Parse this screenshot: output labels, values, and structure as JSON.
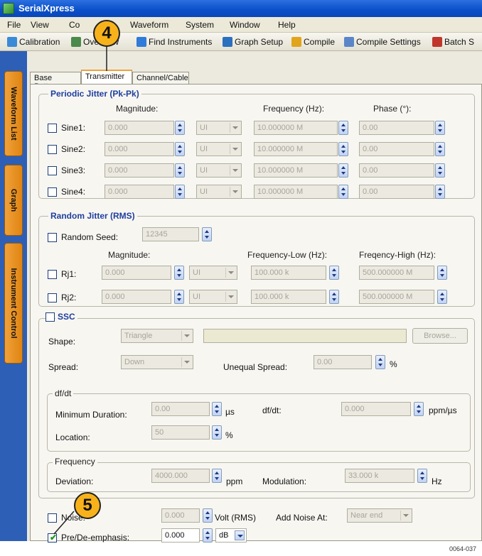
{
  "window": {
    "title": "SerialXpress"
  },
  "menu": [
    "File",
    "View",
    "Co",
    "Waveform",
    "System",
    "Window",
    "Help"
  ],
  "toolbar": [
    {
      "label": "Calibration",
      "icon": "calibration-icon",
      "color": "#3a8ad8"
    },
    {
      "label": "Overview",
      "icon": "overview-icon",
      "color": "#4a8a4a"
    },
    {
      "label": "Find Instruments",
      "icon": "find-instruments-icon",
      "color": "#2f7bd9"
    },
    {
      "label": "Graph Setup",
      "icon": "graph-setup-icon",
      "color": "#2b6fbf"
    },
    {
      "label": "Compile",
      "icon": "compile-icon",
      "color": "#e2a41a"
    },
    {
      "label": "Compile Settings",
      "icon": "compile-settings-icon",
      "color": "#5a86c9"
    },
    {
      "label": "Batch S",
      "icon": "batch-icon",
      "color": "#c0362c"
    }
  ],
  "side_tabs": [
    "Waveform List",
    "Graph",
    "Instrument Control"
  ],
  "tabs": [
    "Base Pattern",
    "Transmitter",
    "Channel/Cable"
  ],
  "callouts": [
    "4",
    "5"
  ],
  "periodic": {
    "title": "Periodic Jitter (Pk-Pk)",
    "headers": {
      "magnitude": "Magnitude:",
      "frequency": "Frequency (Hz):",
      "phase": "Phase (°):"
    },
    "rows": [
      {
        "label": "Sine1:",
        "magnitude": "0.000",
        "unit": "UI",
        "frequency": "10.000000 M",
        "phase": "0.00"
      },
      {
        "label": "Sine2:",
        "magnitude": "0.000",
        "unit": "UI",
        "frequency": "10.000000 M",
        "phase": "0.00"
      },
      {
        "label": "Sine3:",
        "magnitude": "0.000",
        "unit": "UI",
        "frequency": "10.000000 M",
        "phase": "0.00"
      },
      {
        "label": "Sine4:",
        "magnitude": "0.000",
        "unit": "UI",
        "frequency": "10.000000 M",
        "phase": "0.00"
      }
    ]
  },
  "random": {
    "title": "Random Jitter (RMS)",
    "seed_label": "Random Seed:",
    "seed_value": "12345",
    "headers": {
      "magnitude": "Magnitude:",
      "freq_low": "Frequency-Low (Hz):",
      "freq_high": "Freqency-High (Hz):"
    },
    "rows": [
      {
        "label": "Rj1:",
        "magnitude": "0.000",
        "unit": "UI",
        "low": "100.000 k",
        "high": "500.000000 M"
      },
      {
        "label": "Rj2:",
        "magnitude": "0.000",
        "unit": "UI",
        "low": "100.000 k",
        "high": "500.000000 M"
      }
    ]
  },
  "ssc": {
    "title": "SSC",
    "shape_label": "Shape:",
    "shape_value": "Triangle",
    "browse": "Browse...",
    "spread_label": "Spread:",
    "spread_value": "Down",
    "unequal_label": "Unequal Spread:",
    "unequal_value": "0.00",
    "unequal_unit": "%",
    "dfdt": {
      "title": "df/dt",
      "min_label": "Minimum Duration:",
      "min_value": "0.00",
      "min_unit": "µs",
      "dfdt_label": "df/dt:",
      "dfdt_value": "0.000",
      "dfdt_unit": "ppm/µs",
      "loc_label": "Location:",
      "loc_value": "50",
      "loc_unit": "%"
    },
    "frequency": {
      "title": "Frequency",
      "dev_label": "Deviation:",
      "dev_value": "4000.000",
      "dev_unit": "ppm",
      "mod_label": "Modulation:",
      "mod_value": "33.000 k",
      "mod_unit": "Hz"
    }
  },
  "noise": {
    "label": "Noise:",
    "value": "0.000",
    "unit": "Volt (RMS)",
    "add_label": "Add Noise At:",
    "add_value": "Near end"
  },
  "preemph": {
    "label": "Pre/De-emphasis:",
    "value": "0.000",
    "unit": "dB"
  },
  "figure_code": "0064-037"
}
